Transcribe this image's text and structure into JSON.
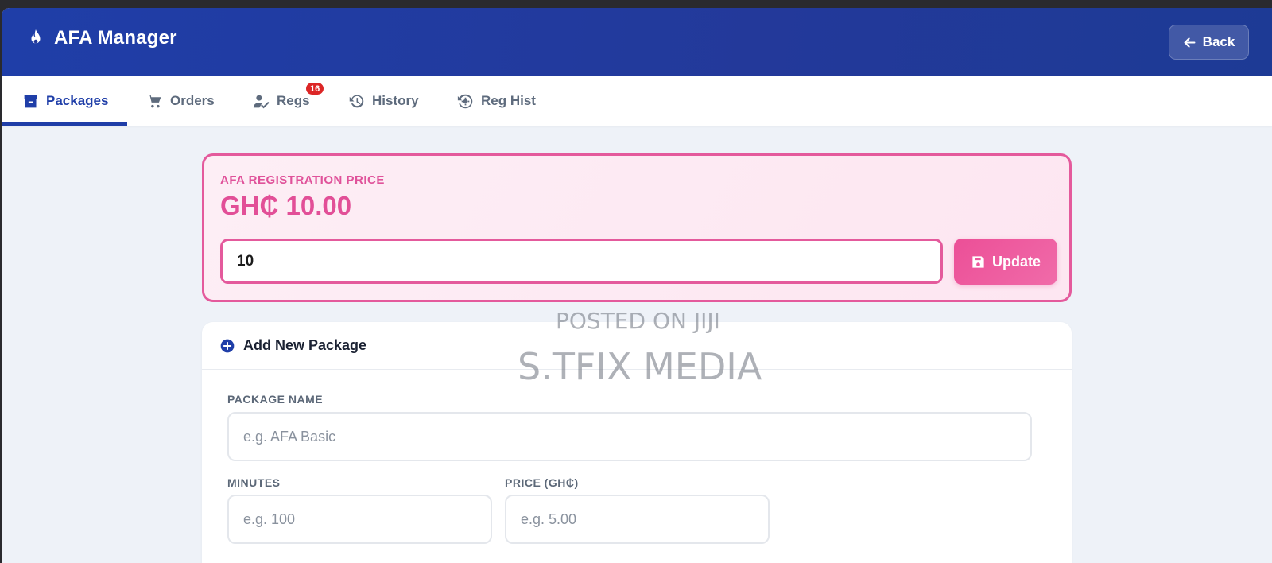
{
  "header": {
    "title": "AFA Manager",
    "brand_icon": "fire-icon",
    "back_label": "Back"
  },
  "tabs": [
    {
      "label": "Packages",
      "icon": "archive-box-icon",
      "active": true
    },
    {
      "label": "Orders",
      "icon": "cart-icon"
    },
    {
      "label": "Regs",
      "icon": "user-check-icon",
      "badge": "16"
    },
    {
      "label": "History",
      "icon": "history-icon"
    },
    {
      "label": "Reg Hist",
      "icon": "settings-history-icon"
    }
  ],
  "price_card": {
    "label": "AFA REGISTRATION PRICE",
    "value": "GH₵ 10.00",
    "input_value": "10",
    "update_label": "Update"
  },
  "add_package": {
    "title": "Add New Package",
    "name_label": "PACKAGE NAME",
    "name_placeholder": "e.g. AFA Basic",
    "minutes_label": "MINUTES",
    "minutes_placeholder": "e.g. 100",
    "price_label": "PRICE (GH₵)",
    "price_placeholder": "e.g. 5.00"
  },
  "watermark": {
    "line1": "POSTED ON JIJI",
    "line2": "S.TFIX MEDIA"
  },
  "colors": {
    "primary": "#1f3ea8",
    "accent_pink": "#e45a9c",
    "badge_red": "#dc2626"
  }
}
